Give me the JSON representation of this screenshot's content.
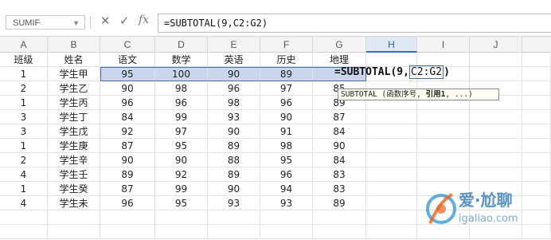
{
  "formula_bar": {
    "name_box": "SUMIF",
    "cancel_icon": "✕",
    "enter_icon": "✓",
    "fx_label": "fx",
    "formula": "=SUBTOTAL(9,C2:G2)"
  },
  "columns": [
    "A",
    "B",
    "C",
    "D",
    "E",
    "F",
    "G",
    "H",
    "I",
    "J"
  ],
  "rows": [
    [
      "班级",
      "姓名",
      "语文",
      "数学",
      "英语",
      "历史",
      "地理"
    ],
    [
      "1",
      "学生甲",
      "95",
      "100",
      "90",
      "89",
      ""
    ],
    [
      "2",
      "学生乙",
      "90",
      "98",
      "96",
      "97",
      "85"
    ],
    [
      "1",
      "学生丙",
      "96",
      "96",
      "98",
      "96",
      "89"
    ],
    [
      "3",
      "学生丁",
      "84",
      "99",
      "93",
      "90",
      "87"
    ],
    [
      "3",
      "学生戊",
      "92",
      "97",
      "90",
      "91",
      "84"
    ],
    [
      "1",
      "学生庚",
      "87",
      "95",
      "89",
      "98",
      "90"
    ],
    [
      "2",
      "学生辛",
      "90",
      "90",
      "88",
      "95",
      "84"
    ],
    [
      "4",
      "学生壬",
      "89",
      "92",
      "89",
      "96",
      "83"
    ],
    [
      "1",
      "学生癸",
      "87",
      "99",
      "90",
      "94",
      "83"
    ],
    [
      "4",
      "学生未",
      "96",
      "95",
      "93",
      "93",
      "89"
    ]
  ],
  "editing": {
    "formula_prefix": "=SUBTOTAL(9,",
    "formula_ref": "C2:G2",
    "formula_suffix": ")",
    "tooltip_prefix": "SUBTOTAL (函数序号, ",
    "tooltip_bold": "引用1",
    "tooltip_suffix": ", ...)"
  },
  "watermark": {
    "line1": "爱·尬聊",
    "line2": "igaliao.com"
  },
  "colors": {
    "selection_fill": "#c9d6ec",
    "selection_border": "#4a6ea9",
    "active_column_header": "#dfe8f3"
  }
}
